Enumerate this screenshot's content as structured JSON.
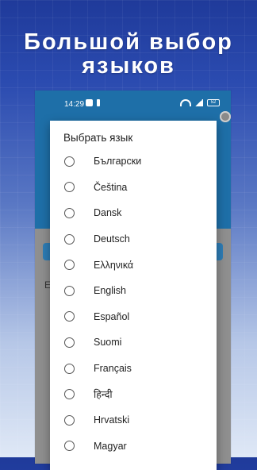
{
  "promo": {
    "line1": "Большой выбор",
    "line2": "языков"
  },
  "status_bar": {
    "time": "14:29",
    "battery": "52"
  },
  "dialog": {
    "title": "Выбрать язык",
    "options": [
      {
        "label": "Български"
      },
      {
        "label": "Čeština"
      },
      {
        "label": "Dansk"
      },
      {
        "label": "Deutsch"
      },
      {
        "label": "Ελληνικά"
      },
      {
        "label": "English"
      },
      {
        "label": "Español"
      },
      {
        "label": "Suomi"
      },
      {
        "label": "Français"
      },
      {
        "label": "हिन्दी"
      },
      {
        "label": "Hrvatski"
      },
      {
        "label": "Magyar"
      }
    ]
  },
  "background_text": {
    "label": "E"
  },
  "colors": {
    "app_primary": "#1e6fa8",
    "promo_text": "#ffffff",
    "dialog_bg": "#ffffff"
  },
  "icons": {
    "settings": "gear-icon",
    "radio": "radio-unchecked-icon"
  }
}
